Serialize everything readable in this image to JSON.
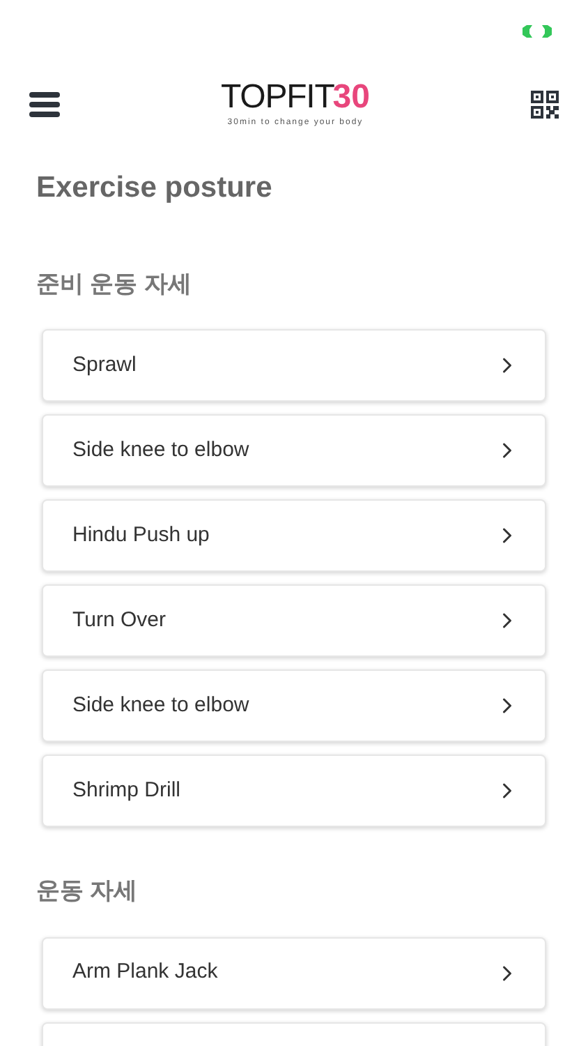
{
  "header": {
    "logo_name": "TOPFIT",
    "logo_number": "30",
    "tagline": "30min to change your body"
  },
  "page_title": "Exercise posture",
  "sections": [
    {
      "heading": "준비 운동 자세",
      "items": [
        {
          "label": "Sprawl"
        },
        {
          "label": "Side knee to elbow"
        },
        {
          "label": "Hindu Push up"
        },
        {
          "label": "Turn Over"
        },
        {
          "label": "Side knee to elbow"
        },
        {
          "label": "Shrimp Drill"
        }
      ]
    },
    {
      "heading": "운동 자세",
      "items": [
        {
          "label": "Arm Plank Jack"
        }
      ]
    }
  ]
}
